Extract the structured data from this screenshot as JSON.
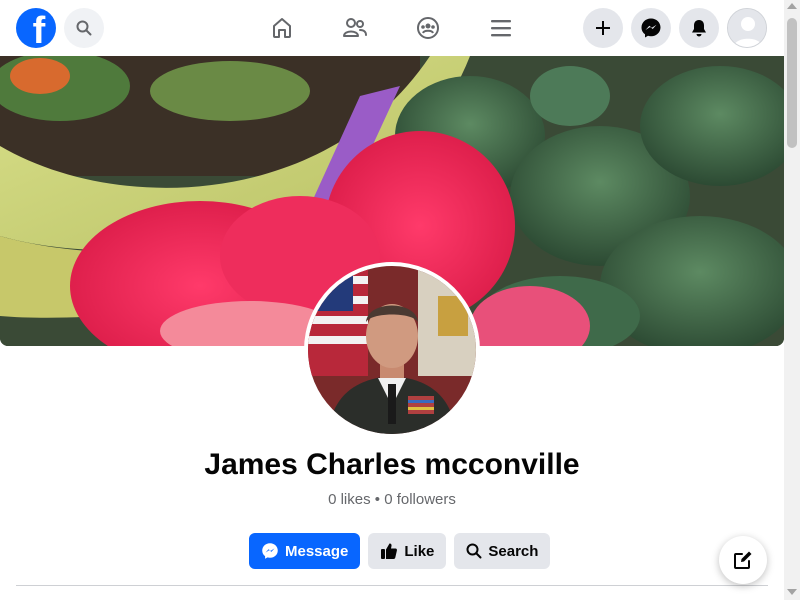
{
  "header": {
    "logo_letter": "f",
    "icons": [
      "facebook-logo",
      "search-icon",
      "home-icon",
      "friends-icon",
      "groups-icon",
      "menu-icon",
      "plus-icon",
      "messenger-icon",
      "bell-icon",
      "avatar"
    ]
  },
  "profile": {
    "name": "James Charles mcconville",
    "stats": "0 likes • 0 followers"
  },
  "actions": {
    "message_label": "Message",
    "like_label": "Like",
    "search_label": "Search"
  },
  "colors": {
    "brand": "#0866ff",
    "button_secondary": "#e4e6eb",
    "text_primary": "#050505",
    "text_secondary": "#65676b"
  }
}
